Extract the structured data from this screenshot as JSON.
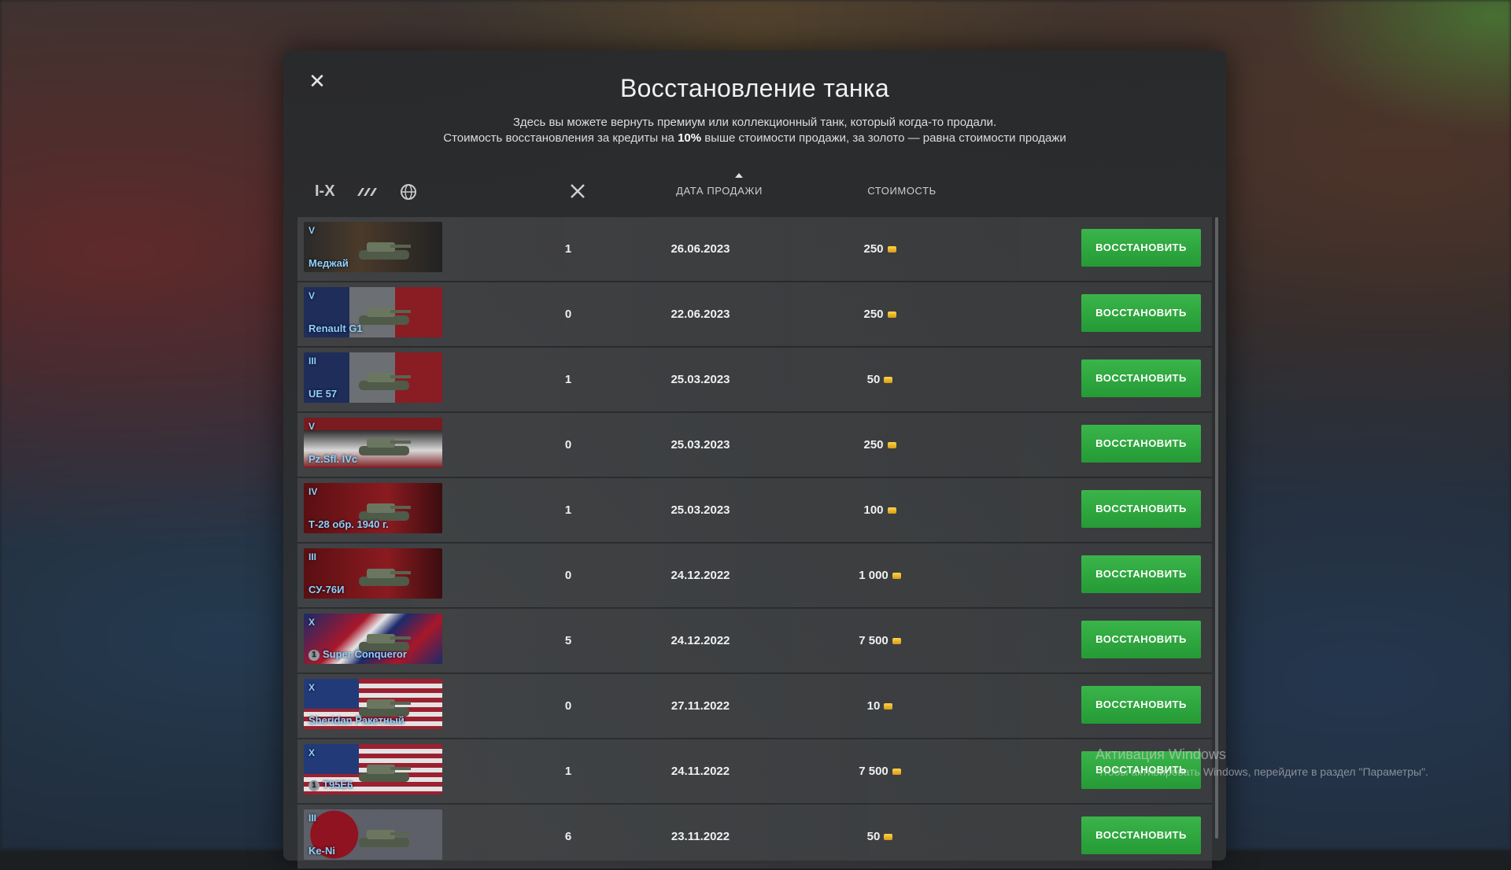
{
  "dialog": {
    "title": "Восстановление танка",
    "description_line1": "Здесь вы можете вернуть премиум или коллекционный танк, который когда-то продали.",
    "description_line2_pre": "Стоимость восстановления за кредиты на ",
    "description_line2_bold": "10%",
    "description_line2_post": " выше стоимости продажи, за золото — равна стоимости продажи",
    "close_icon": "close-icon"
  },
  "filters": {
    "tier_label": "I-X",
    "type_icon": "vehicle-type-icon",
    "nation_icon": "globe-icon"
  },
  "columns": {
    "battles_icon": "crossed-swords-icon",
    "date": "ДАТА ПРОДАЖИ",
    "price": "СТОИМОСТЬ",
    "sort": "ascending-arrow"
  },
  "restore_label": "ВОССТАНОВИТЬ",
  "rows": [
    {
      "tier": "V",
      "name": "Меджай",
      "battles": "1",
      "date": "26.06.2023",
      "price": "250",
      "flag": "ru",
      "badge": ""
    },
    {
      "tier": "V",
      "name": "Renault G1",
      "battles": "0",
      "date": "22.06.2023",
      "price": "250",
      "flag": "fr",
      "badge": ""
    },
    {
      "tier": "III",
      "name": "UE 57",
      "battles": "1",
      "date": "25.03.2023",
      "price": "50",
      "flag": "fr",
      "badge": ""
    },
    {
      "tier": "V",
      "name": "Pz.Sfl. IVc",
      "battles": "0",
      "date": "25.03.2023",
      "price": "250",
      "flag": "de",
      "badge": ""
    },
    {
      "tier": "IV",
      "name": "Т-28 обр. 1940 г.",
      "battles": "1",
      "date": "25.03.2023",
      "price": "100",
      "flag": "su",
      "badge": ""
    },
    {
      "tier": "III",
      "name": "СУ-76И",
      "battles": "0",
      "date": "24.12.2022",
      "price": "1 000",
      "flag": "su",
      "badge": ""
    },
    {
      "tier": "X",
      "name": "Super Conqueror",
      "battles": "5",
      "date": "24.12.2022",
      "price": "7 500",
      "flag": "uk",
      "badge": "1"
    },
    {
      "tier": "X",
      "name": "Sheridan Ракетный",
      "battles": "0",
      "date": "27.11.2022",
      "price": "10",
      "flag": "us",
      "badge": ""
    },
    {
      "tier": "X",
      "name": "T95E6",
      "battles": "1",
      "date": "24.11.2022",
      "price": "7 500",
      "flag": "us",
      "badge": "1"
    },
    {
      "tier": "III",
      "name": "Ke-Ni",
      "battles": "6",
      "date": "23.11.2022",
      "price": "50",
      "flag": "jp",
      "badge": ""
    }
  ],
  "watermark": {
    "title": "Активация Windows",
    "subtitle": "Чтобы активировать Windows, перейдите в раздел \"Параметры\"."
  },
  "colors": {
    "accent_green": "#2ea83e",
    "tank_name_blue": "#8fd0ff"
  }
}
